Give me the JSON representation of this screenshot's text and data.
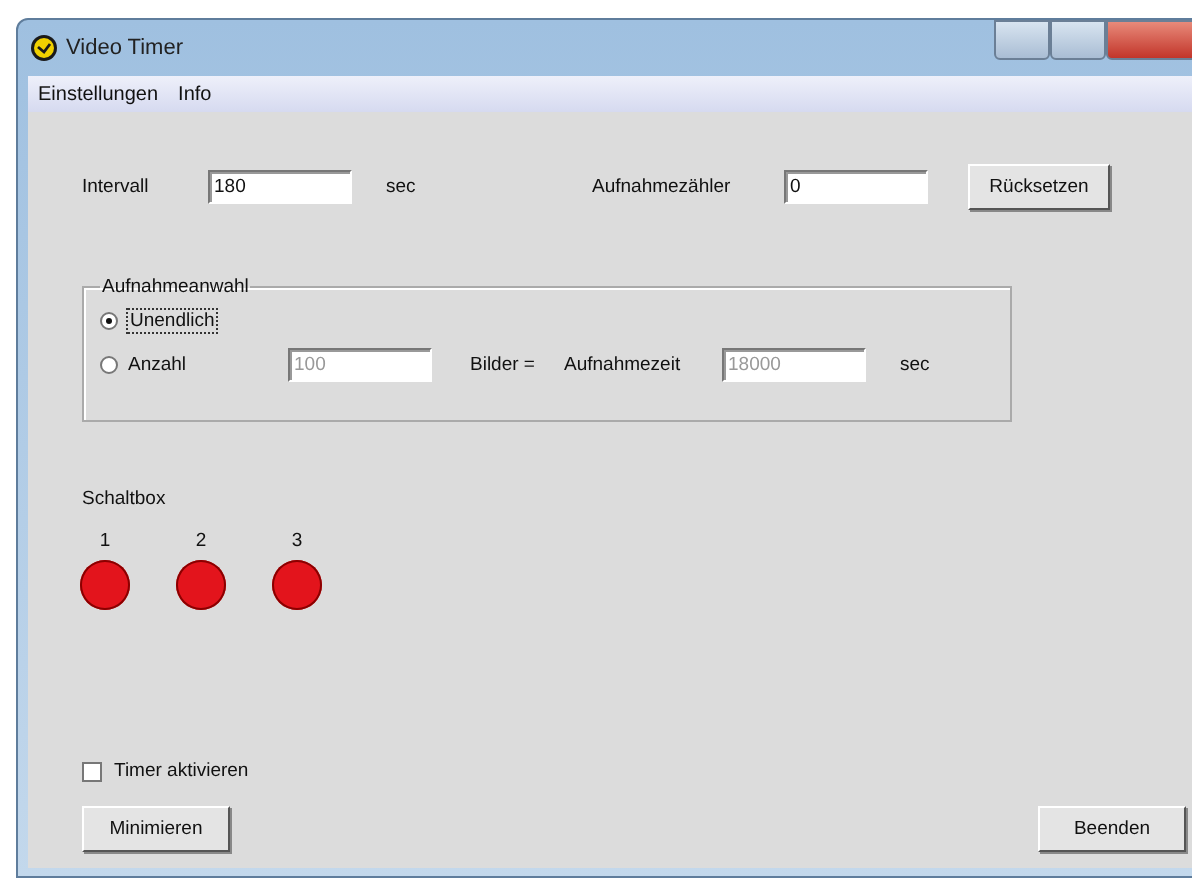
{
  "window": {
    "title": "Video Timer"
  },
  "menu": [
    {
      "label": "Einstellungen"
    },
    {
      "label": "Info"
    }
  ],
  "interval": {
    "label": "Intervall",
    "value": "180",
    "unit": "sec"
  },
  "counter": {
    "label": "Aufnahmezähler",
    "value": "0",
    "button": "Rücksetzen"
  },
  "group": {
    "title": "Aufnahmeanwahl",
    "options": [
      {
        "label": "Unendlich",
        "selected": true
      },
      {
        "label": "Anzahl",
        "selected": false
      }
    ],
    "count_value": "100",
    "count_unit": "Bilder =",
    "time_label": "Aufnahmezeit",
    "time_value": "18000",
    "time_unit": "sec",
    "disabled": true
  },
  "switchbox": {
    "label": "Schaltbox",
    "lamps": [
      {
        "number": "1",
        "color": "#e3141c"
      },
      {
        "number": "2",
        "color": "#e3141c"
      },
      {
        "number": "3",
        "color": "#e3141c"
      }
    ]
  },
  "timer": {
    "label": "Timer aktivieren",
    "checked": false
  },
  "buttons": [
    {
      "label": "Minimieren"
    },
    {
      "label": "Beenden"
    }
  ]
}
